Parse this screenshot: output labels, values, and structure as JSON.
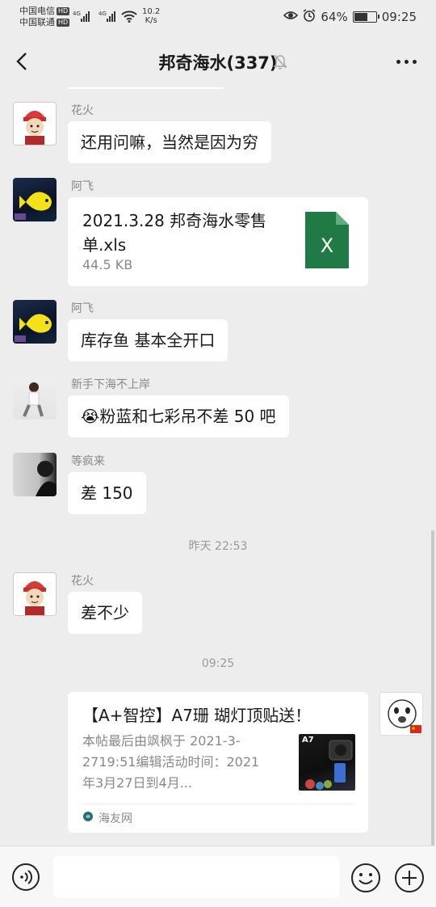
{
  "status_bar": {
    "carrier1": "中国电信",
    "carrier2": "中国联通",
    "hd": "HD",
    "signal1": "4G",
    "signal2": "4G",
    "net_speed_value": "10.2",
    "net_speed_unit": "K/s",
    "battery_percent": "64%",
    "battery_level": 0.64,
    "time": "09:25"
  },
  "nav": {
    "title": "邦奇海水(337)",
    "icons": {
      "back": "back-arrow-icon",
      "mute": "mute-bell-icon",
      "more": "more-dots-icon"
    }
  },
  "messages": [
    {
      "sender": "花火",
      "text": "还用问嘛，当然是因为穷"
    },
    {
      "sender": "阿飞",
      "file_name": "2021.3.28 邦奇海水零售单.xls",
      "file_size": "44.5 KB",
      "file_icon_letter": "X"
    },
    {
      "sender": "阿飞",
      "text": "库存鱼 基本全开口"
    },
    {
      "sender": "新手下海不上岸",
      "text": "粉蓝和七彩吊不差 50 吧",
      "emoji": "😭"
    },
    {
      "sender": "等疯来",
      "text": "差 150"
    },
    {
      "sender": "花火",
      "text": "差不少"
    }
  ],
  "timestamps": [
    "昨天 22:53",
    "09:25"
  ],
  "link_card": {
    "title": "【A+智控】A7珊 瑚灯顶贴送！",
    "description": "本帖最后由飒枫于 2021-3-2719:51编辑活动时间：2021年3月27日到4月...",
    "thumb_label": "A7",
    "source": "海友网"
  },
  "input_bar": {
    "placeholder": "",
    "icons": {
      "voice": "voice-icon",
      "emoji": "emoji-icon",
      "more": "plus-icon"
    }
  }
}
